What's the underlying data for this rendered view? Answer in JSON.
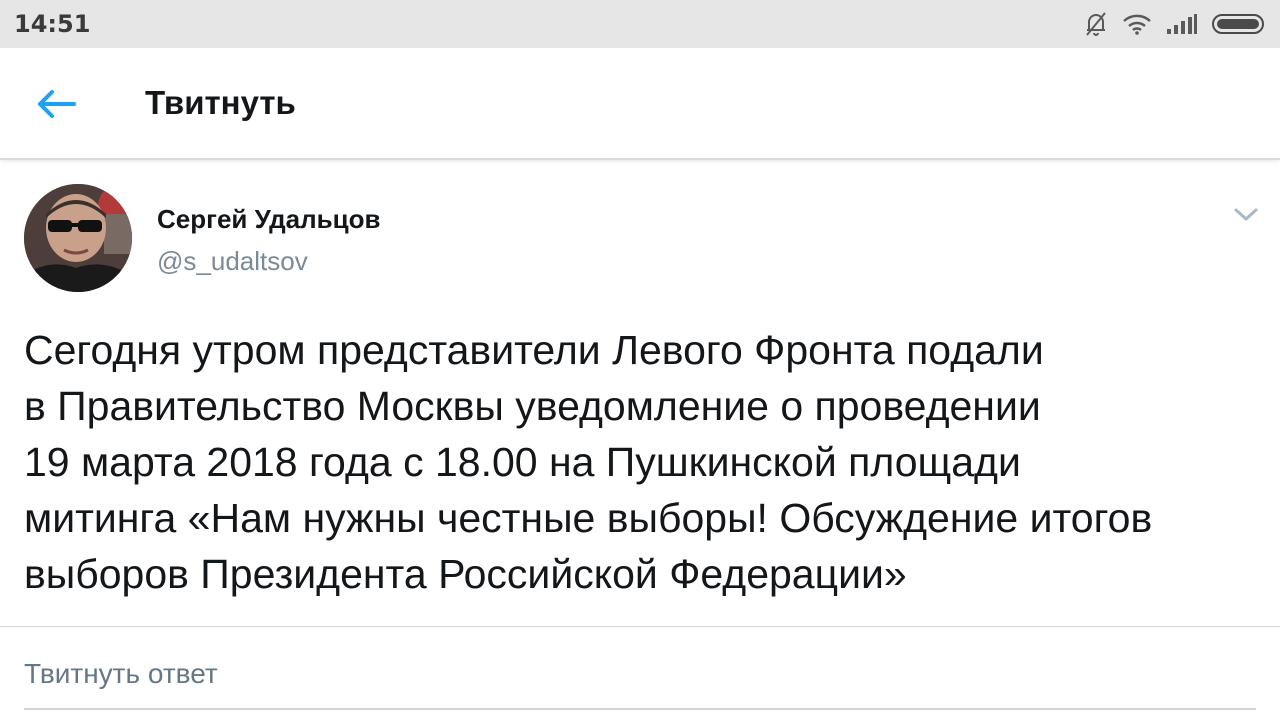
{
  "status_bar": {
    "time": "14:51",
    "icons": [
      "mute-bell-icon",
      "wifi-icon",
      "signal-icon",
      "battery-icon"
    ]
  },
  "header": {
    "title": "Твитнуть",
    "back_icon": "back-arrow-icon",
    "accent_color": "#1da1f2"
  },
  "tweet": {
    "author_name": "Сергей Удальцов",
    "author_handle": "@s_udaltsov",
    "menu_icon": "chevron-down-icon",
    "text_lines": [
      "Сегодня утром представители Левого Фронта подали",
      "в Правительство Москвы уведомление о проведении",
      "19 марта 2018 года с 18.00 на Пушкинской площади",
      "митинга «Нам нужны честные выборы! Обсуждение итогов",
      "выборов Президента Российской Федерации»"
    ]
  },
  "reply": {
    "placeholder": "Твитнуть ответ"
  }
}
